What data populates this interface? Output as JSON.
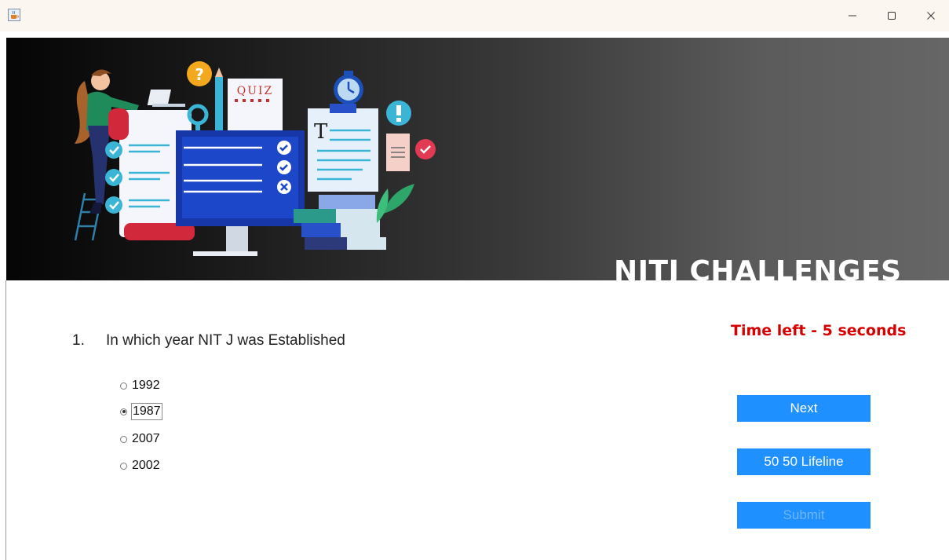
{
  "window": {
    "app_icon": "java-cup-icon",
    "controls": [
      "minimize-icon",
      "maximize-icon",
      "close-icon"
    ]
  },
  "banner": {
    "title": "NITJ CHALLENGES",
    "quiz_sign": "QUIZ",
    "doc_letter": "T",
    "question_mark": "?"
  },
  "question": {
    "number": "1.",
    "text": "In which year NIT J was Established",
    "options": [
      {
        "label": "1992",
        "selected": false
      },
      {
        "label": "1987",
        "selected": true
      },
      {
        "label": "2007",
        "selected": false
      },
      {
        "label": "2002",
        "selected": false
      }
    ]
  },
  "timer": {
    "text": "Time left - 5 seconds",
    "color": "#d60000"
  },
  "buttons": {
    "next": "Next",
    "lifeline": "50 50 Lifeline",
    "submit": "Submit",
    "submit_enabled": false,
    "accent": "#1e90ff"
  }
}
